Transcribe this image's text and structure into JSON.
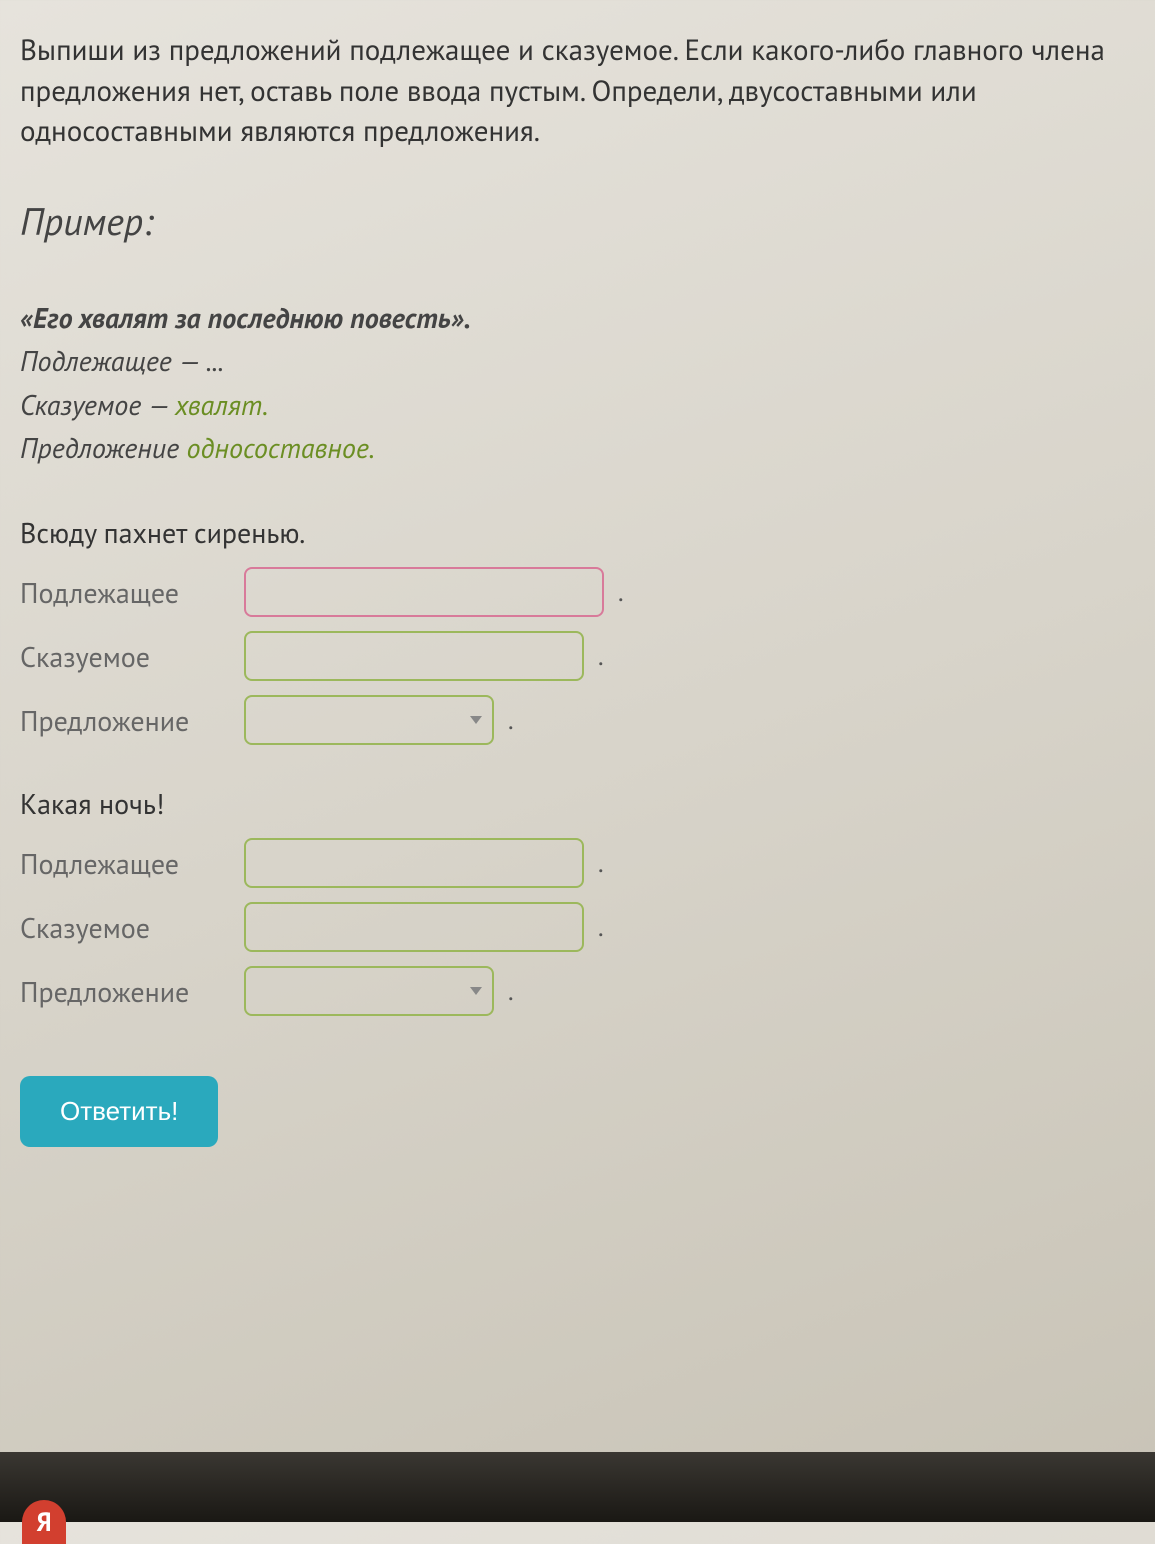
{
  "task": "Выпиши из предложений подлежащее и сказуемое. Если какого-либо главного члена предложения нет, оставь поле ввода пустым. Определи, двусоставными или односоставными являются предложения.",
  "example": {
    "heading": "Пример:",
    "quote": "«Его хвалят за последнюю повесть».",
    "subject_line_label": "Подлежащее — ",
    "subject_line_value": "...",
    "predicate_line_label": "Сказуемое — ",
    "predicate_line_value": "хвалят.",
    "sentence_type_label": "Предложение ",
    "sentence_type_value": "односоставное."
  },
  "questions": [
    {
      "sentence": "Всюду пахнет сиренью.",
      "labels": {
        "subject": "Подлежащее",
        "predicate": "Сказуемое",
        "type": "Предложение"
      },
      "values": {
        "subject": "",
        "predicate": "",
        "type": ""
      }
    },
    {
      "sentence": "Какая ночь!",
      "labels": {
        "subject": "Подлежащее",
        "predicate": "Сказуемое",
        "type": "Предложение"
      },
      "values": {
        "subject": "",
        "predicate": "",
        "type": ""
      }
    }
  ],
  "submit_label": "Ответить!",
  "badge": "Я",
  "period": "."
}
